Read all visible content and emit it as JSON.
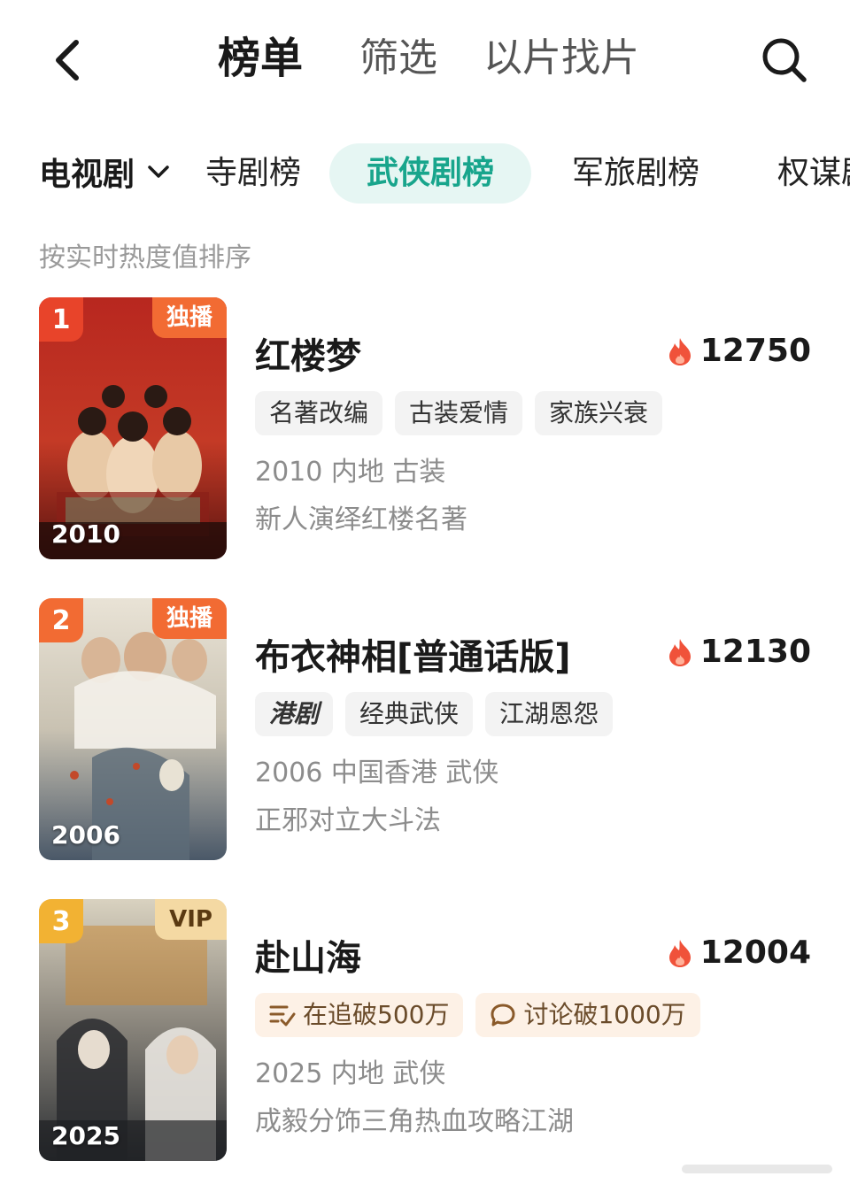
{
  "header": {
    "tabs": [
      {
        "label": "榜单",
        "active": true
      },
      {
        "label": "筛选",
        "active": false
      },
      {
        "label": "以片找片",
        "active": false
      }
    ],
    "back_icon": "chevron-left-icon",
    "search_icon": "search-icon"
  },
  "categories": {
    "dropdown_label": "电视剧",
    "pills": [
      {
        "label": "寺剧榜",
        "active": false
      },
      {
        "label": "武侠剧榜",
        "active": true
      },
      {
        "label": "军旅剧榜",
        "active": false
      },
      {
        "label": "权谋剧",
        "active": false
      }
    ],
    "accent_color": "#18a58c"
  },
  "sort_label": "按实时热度值排序",
  "items": [
    {
      "rank": "1",
      "rank_color": "#f26b33",
      "corner_tag": "独播",
      "corner_color": "#f26b33",
      "poster_year": "2010",
      "title": "红楼梦",
      "heat": "12750",
      "tags": [
        "名著改编",
        "古装爱情",
        "家族兴衰"
      ],
      "meta": "2010 内地 古装",
      "desc": "新人演绎红楼名著"
    },
    {
      "rank": "2",
      "rank_color": "#f26b33",
      "corner_tag": "独播",
      "corner_color": "#f26b33",
      "poster_year": "2006",
      "title": "布衣神相[普通话版]",
      "heat": "12130",
      "tags": [
        "港剧",
        "经典武侠",
        "江湖恩怨"
      ],
      "meta": "2006 中国香港 武侠",
      "desc": "正邪对立大斗法"
    },
    {
      "rank": "3",
      "rank_color": "#f2b233",
      "corner_tag": "VIP",
      "corner_color": "#f4d9a3",
      "poster_year": "2025",
      "title": "赴山海",
      "heat": "12004",
      "hot_tags": [
        {
          "icon": "trending-list-icon",
          "label": "在追破500万"
        },
        {
          "icon": "comment-bubble-icon",
          "label": "讨论破1000万"
        }
      ],
      "meta": "2025 内地 武侠",
      "desc": "成毅分饰三角热血攻略江湖"
    }
  ]
}
